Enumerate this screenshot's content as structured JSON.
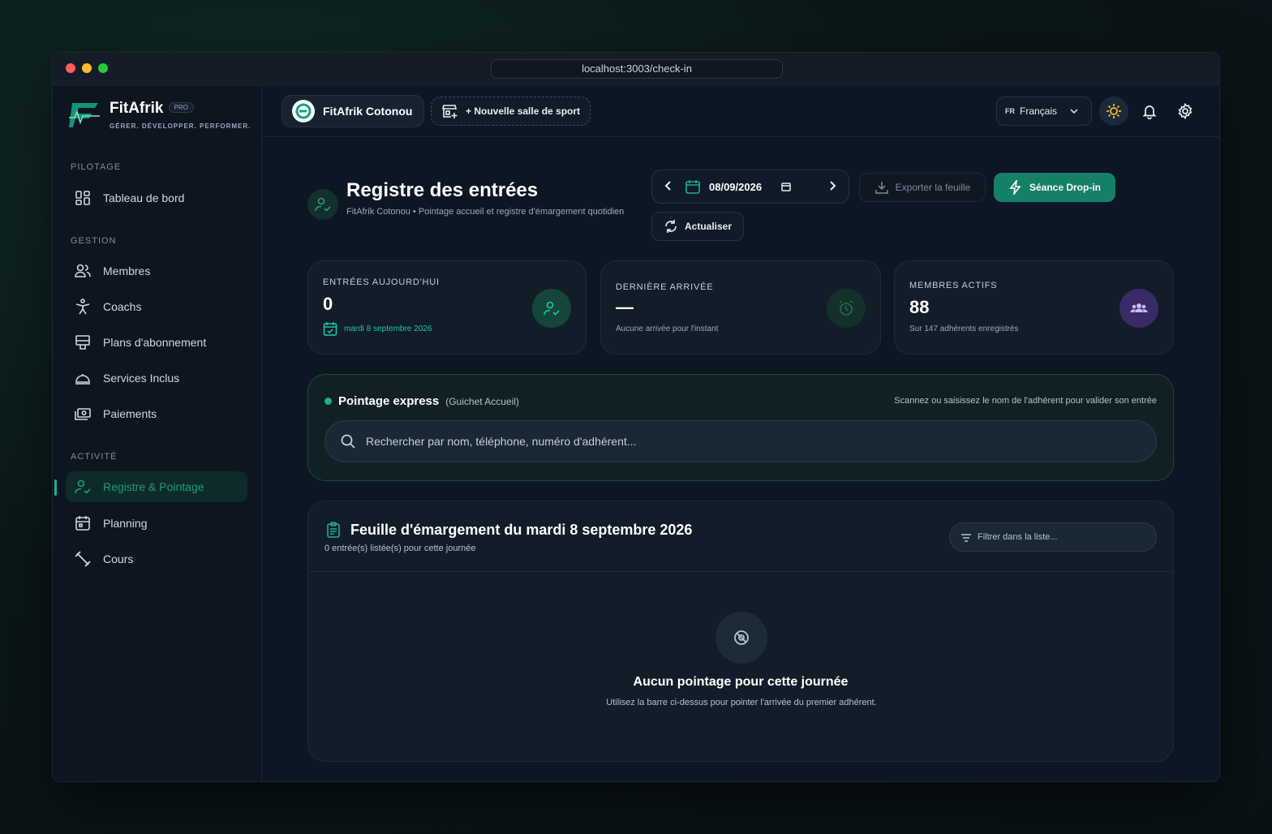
{
  "browser": {
    "url": "localhost:3003/check-in"
  },
  "brand": {
    "name": "FitAfrik",
    "badge": "PRO",
    "tagline": "GÉRER. DÉVELOPPER. PERFORMER."
  },
  "sidebar": {
    "sections": [
      {
        "label": "PILOTAGE"
      },
      {
        "label": "GESTION"
      },
      {
        "label": "ACTIVITÉ"
      }
    ],
    "items": [
      {
        "label": "Tableau de bord",
        "icon": "dashboard-icon"
      },
      {
        "label": "Membres",
        "icon": "users-icon"
      },
      {
        "label": "Coachs",
        "icon": "coach-icon"
      },
      {
        "label": "Plans d'abonnement",
        "icon": "plans-icon"
      },
      {
        "label": "Services Inclus",
        "icon": "services-icon"
      },
      {
        "label": "Paiements",
        "icon": "payments-icon"
      },
      {
        "label": "Registre & Pointage",
        "icon": "checkin-icon",
        "active": true
      },
      {
        "label": "Planning",
        "icon": "calendar-icon"
      },
      {
        "label": "Cours",
        "icon": "dumbbell-icon"
      }
    ]
  },
  "topbar": {
    "gym_name": "FitAfrik Cotonou",
    "new_gym": "+ Nouvelle salle de sport",
    "lang_code": "FR",
    "lang_label": "Français"
  },
  "page": {
    "title": "Registre des entrées",
    "subtitle": "FitAfrik Cotonou • Pointage accueil et registre d'émargement quotidien",
    "date": "08/09/2026",
    "export_label": "Exporter la feuille",
    "dropin_label": "Séance Drop-in",
    "refresh_label": "Actualiser"
  },
  "stats": [
    {
      "label": "ENTRÉES AUJOURD'HUI",
      "value": "0",
      "foot": "mardi 8 septembre 2026",
      "icon": "user-check-icon"
    },
    {
      "label": "DERNIÈRE ARRIVÉE",
      "value": "—",
      "foot": "Aucune arrivée pour l'instant",
      "icon": "alarm-icon"
    },
    {
      "label": "MEMBRES ACTIFS",
      "value": "88",
      "foot": "Sur 147 adhérents enregistrés",
      "icon": "group-icon"
    }
  ],
  "express": {
    "title": "Pointage express",
    "subtitle": "(Guichet Accueil)",
    "hint": "Scannez ou saisissez le nom de l'adhérent pour valider son entrée",
    "placeholder": "Rechercher par nom, téléphone, numéro d'adhérent..."
  },
  "sheet": {
    "title": "Feuille d'émargement du mardi 8 septembre 2026",
    "subtitle": "0 entrée(s) listée(s) pour cette journée",
    "filter_placeholder": "Filtrer dans la liste...",
    "empty_title": "Aucun pointage pour cette journée",
    "empty_sub": "Utilisez la barre ci-dessus pour pointer l'arrivée du premier adhérent."
  },
  "colors": {
    "accent": "#1fae8c",
    "dropin": "#15806a",
    "background": "#0d1723",
    "purple": "#3a2a66"
  }
}
